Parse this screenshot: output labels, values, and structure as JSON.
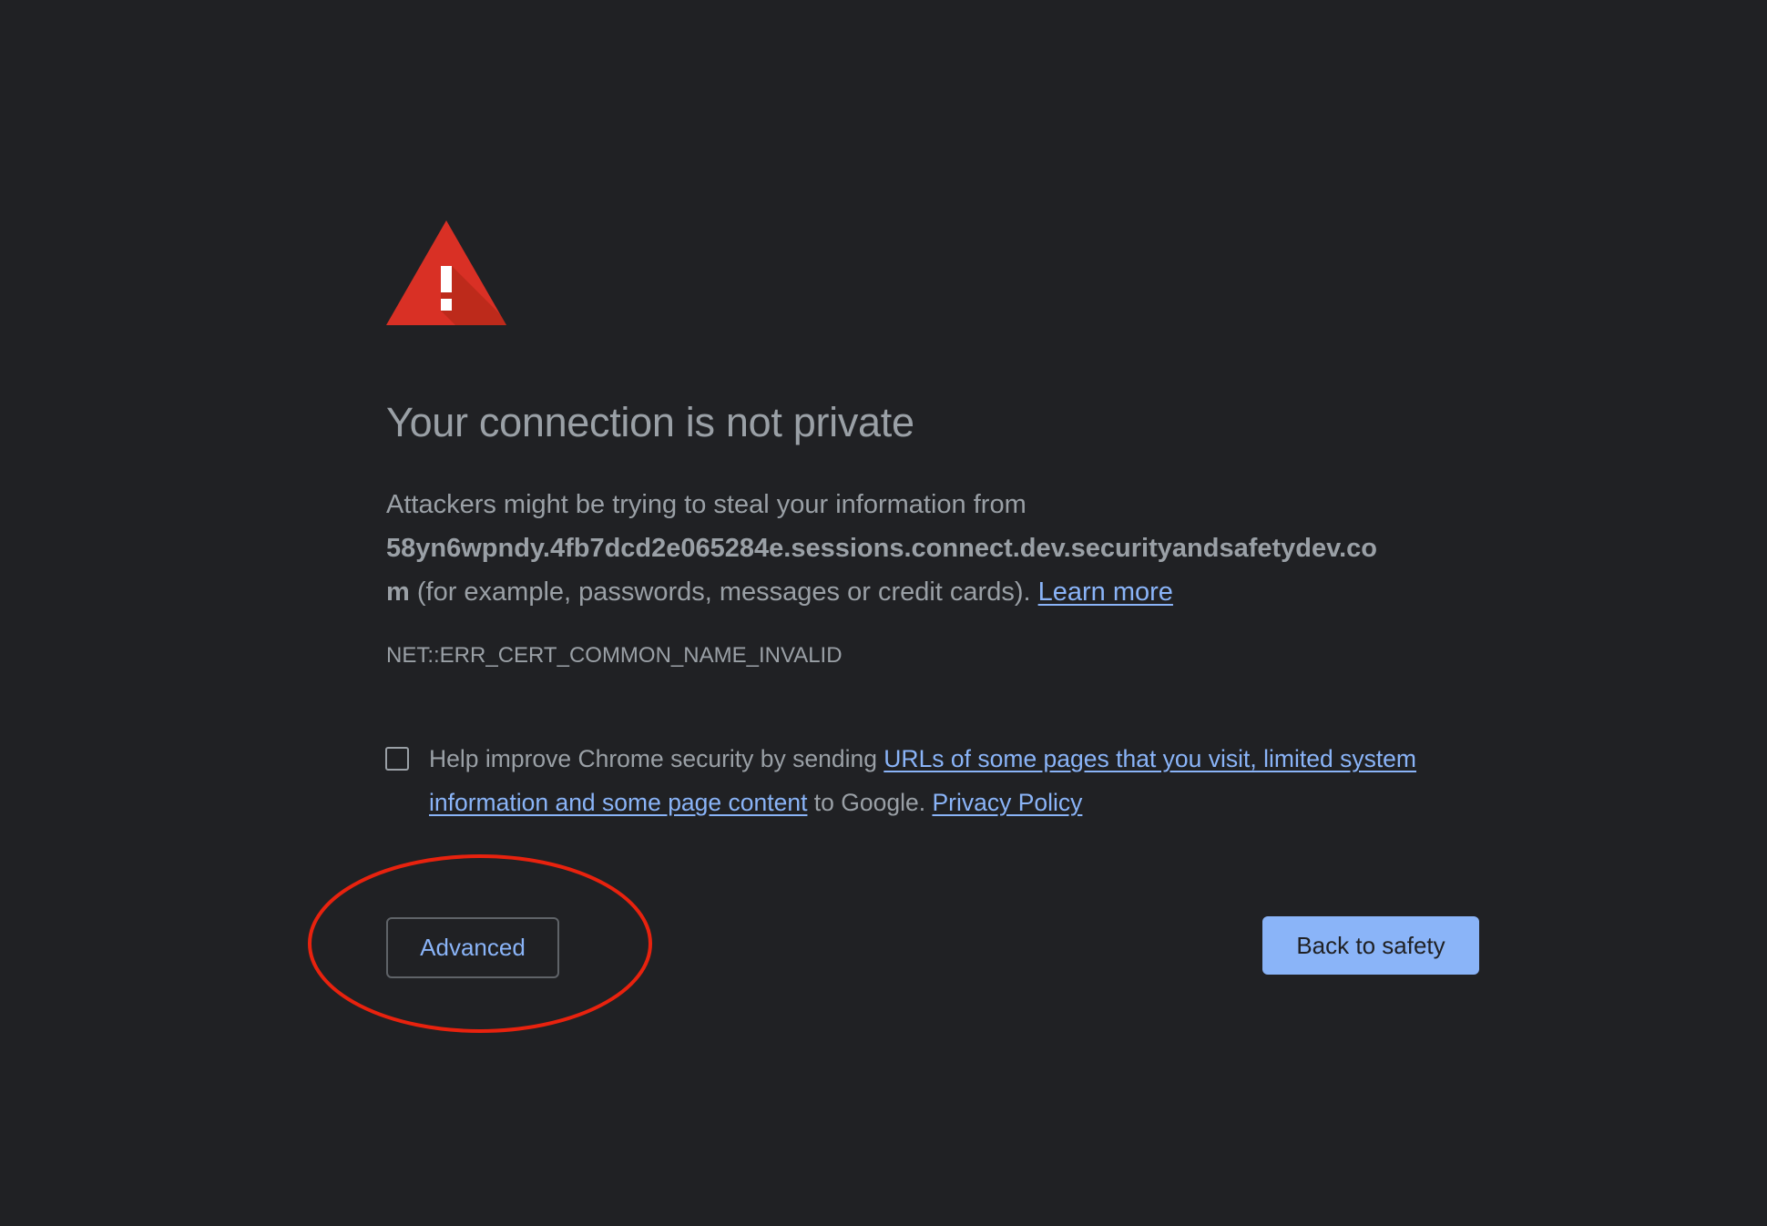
{
  "heading": {
    "title": "Your connection is not private"
  },
  "explanation": {
    "line1": "Attackers might be trying to steal your information from",
    "domain_line2": "58yn6wpndy.4fb7dcd2e065284e.sessions.connect.dev.securityandsafetydev.co",
    "domain_line3": "m",
    "details": " (for example, passwords, messages or credit cards). ",
    "learn_more": "Learn more"
  },
  "error_code": "NET::ERR_CERT_COMMON_NAME_INVALID",
  "optin": {
    "checked": false,
    "prefix": "Help improve Chrome security by sending ",
    "link_line1": "URLs of some pages that you visit, limited system",
    "link_line2": "information and some page content",
    "middle": " to Google. ",
    "privacy_link": "Privacy Policy"
  },
  "buttons": {
    "advanced": "Advanced",
    "back_to_safety": "Back to safety"
  },
  "icons": {
    "warning": "warning-triangle-icon"
  },
  "colors": {
    "background": "#202124",
    "text": "#9aa0a6",
    "link": "#8ab4f8",
    "primary_button": "#8ab4f8",
    "warning_red": "#d93025",
    "annotation": "#e8220e"
  }
}
